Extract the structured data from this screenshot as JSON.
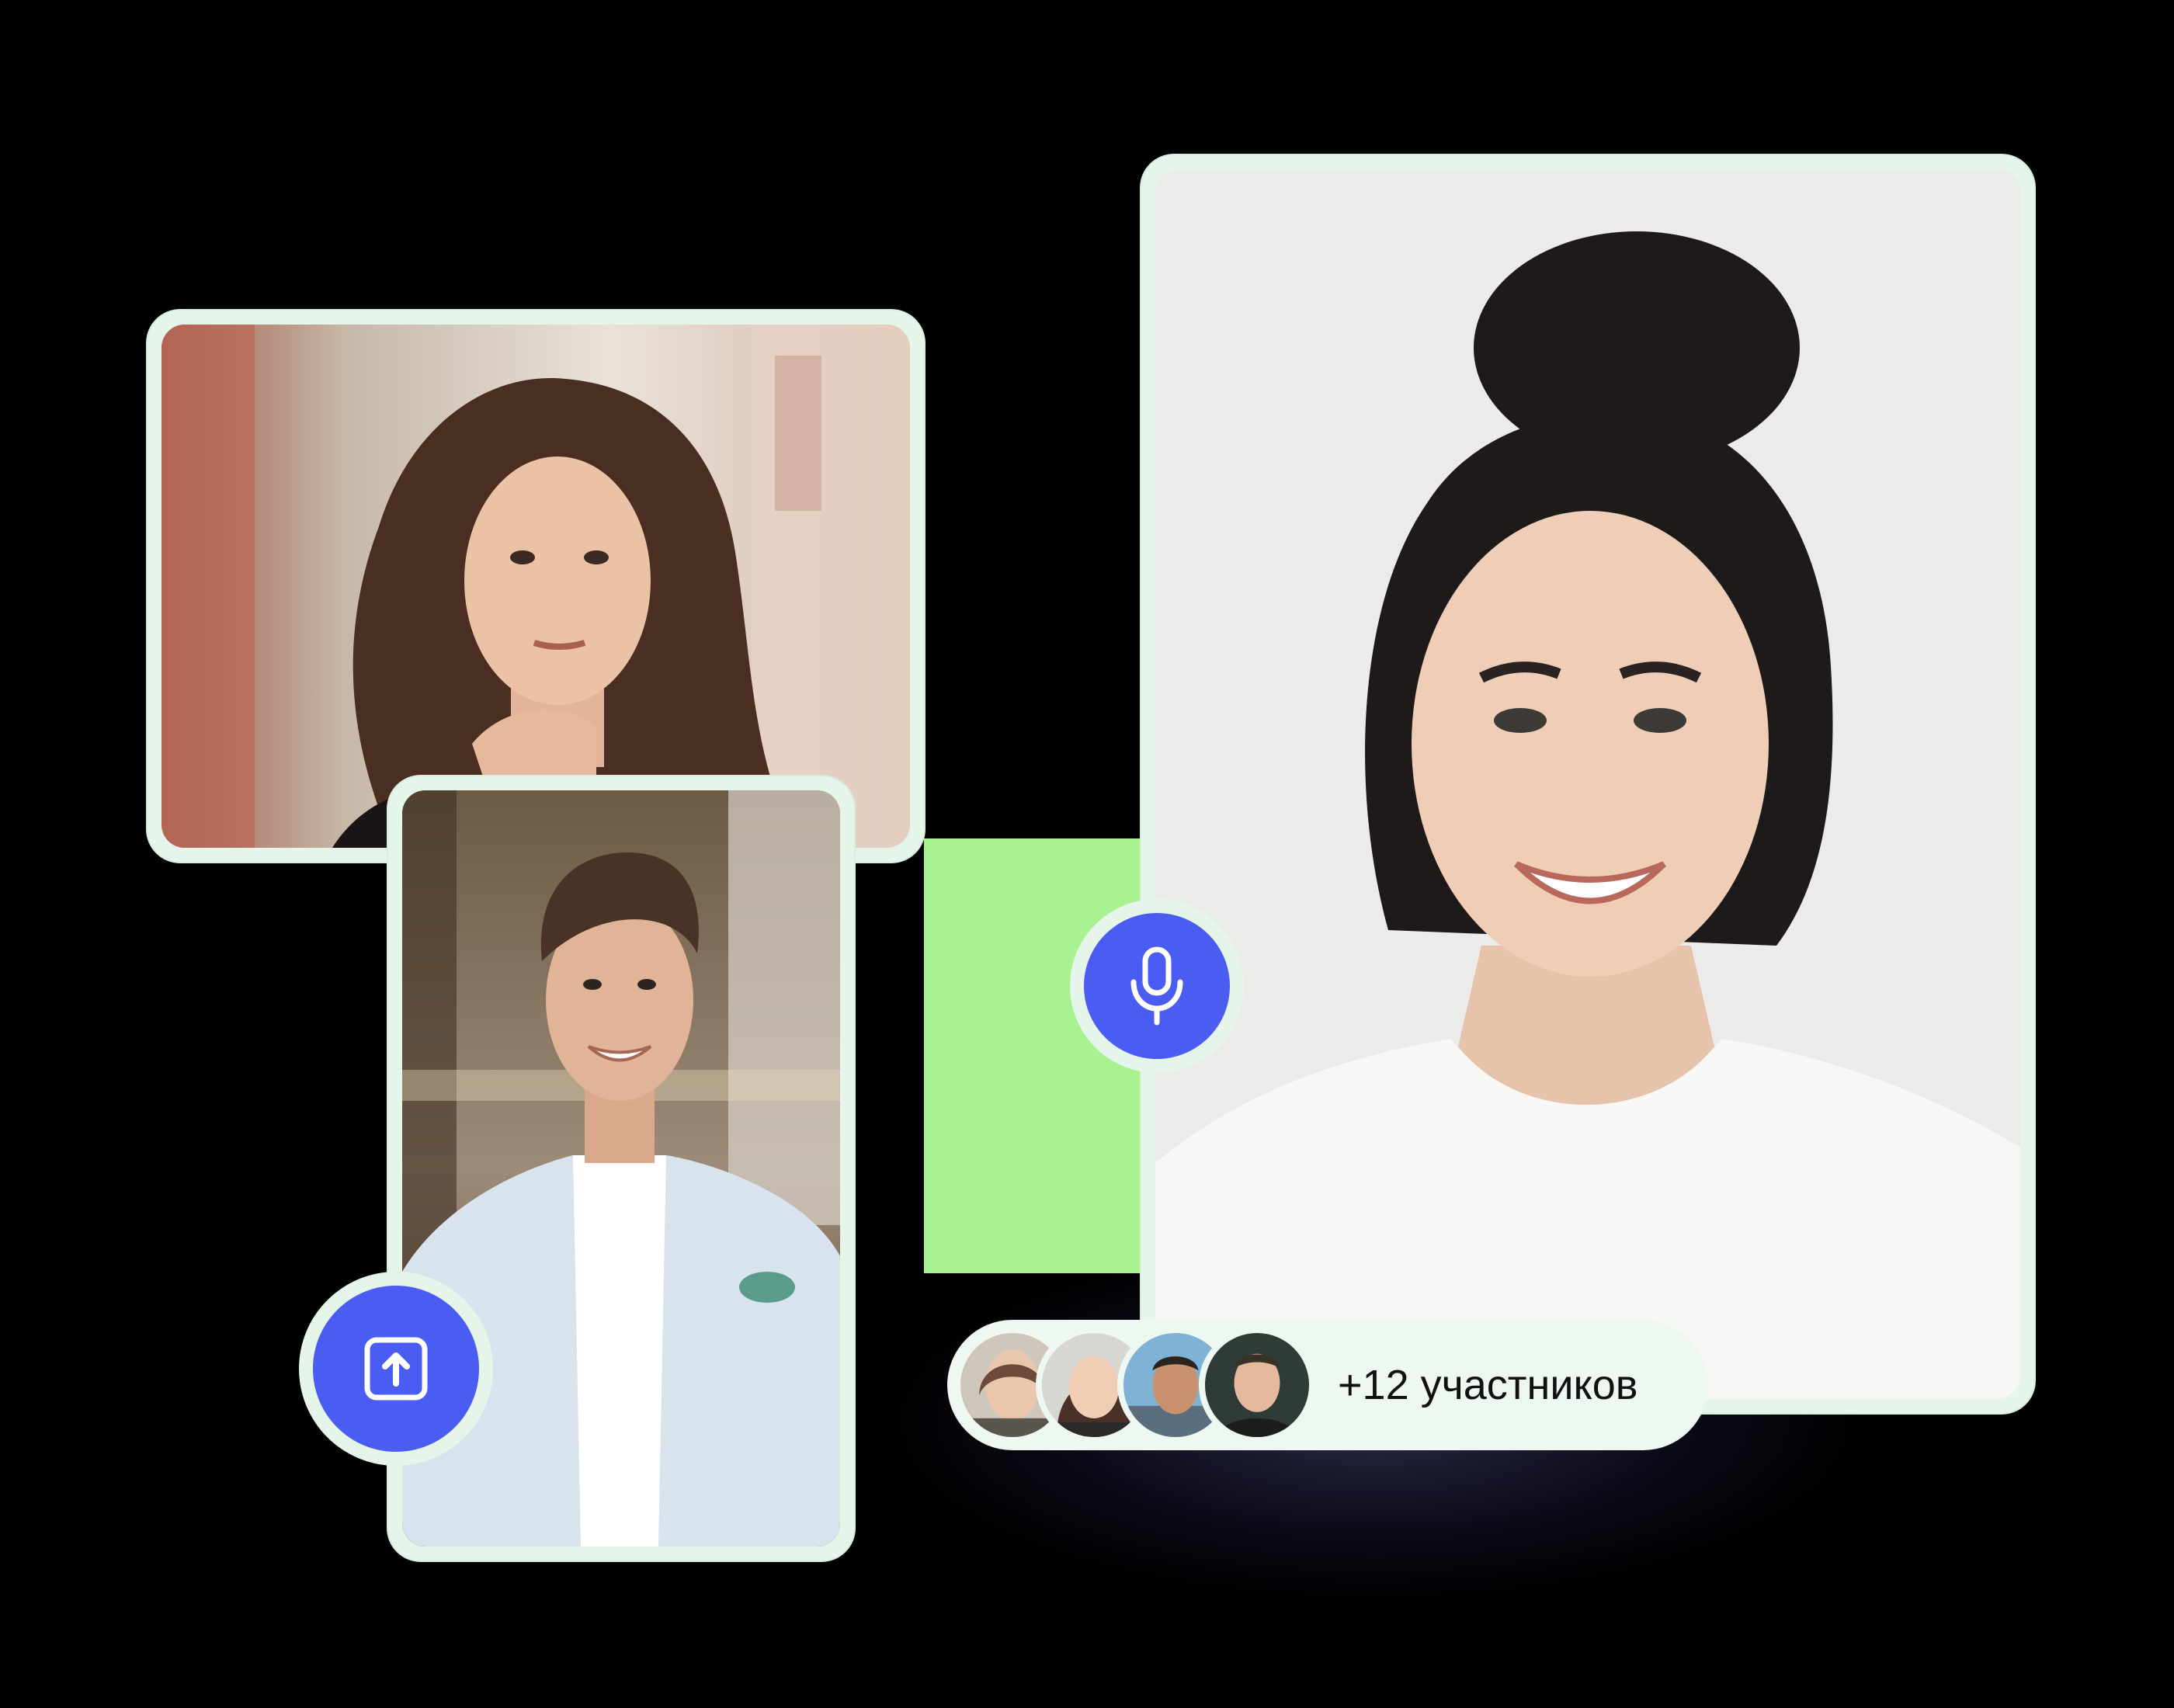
{
  "participants": {
    "count_label": "+12 участников",
    "avatars": [
      {
        "name": "participant-avatar-1"
      },
      {
        "name": "participant-avatar-2"
      },
      {
        "name": "participant-avatar-3"
      },
      {
        "name": "participant-avatar-4"
      }
    ]
  },
  "controls": {
    "share_icon": "share-screen-icon",
    "mic_icon": "microphone-icon"
  },
  "colors": {
    "accent": "#4a5cf2",
    "tile_border": "#e6f5ea",
    "glow": "#a8f291",
    "background": "#000000"
  }
}
